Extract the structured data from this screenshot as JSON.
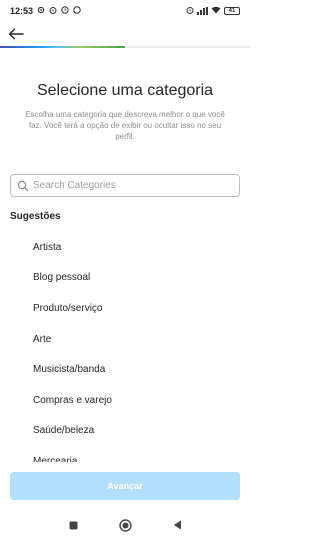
{
  "status_bar": {
    "time": "12:53",
    "battery": "41",
    "notification_icons": [
      "gear-icon",
      "alarm-icon",
      "clock-icon",
      "whatsapp-icon"
    ],
    "system_icons": [
      "alarm-icon",
      "wifi-icon",
      "signal-icon",
      "battery-icon"
    ]
  },
  "header": {
    "back_icon": "arrow-left-icon",
    "progress": 0.5,
    "progress_colors": [
      "#3f51b5",
      "#2196f3",
      "#4fc3f7",
      "#9ccc65",
      "#43a047"
    ]
  },
  "main": {
    "title": "Selecione uma categoria",
    "subtitle": "Escolha uma categoria que descreva melhor o que você faz. Você terá a opção de exibir ou ocultar isso no seu perfil.",
    "search": {
      "placeholder": "Search Categories",
      "value": ""
    },
    "suggestions_label": "Sugestões",
    "categories": [
      "Artista",
      "Blog pessoal",
      "Produto/serviço",
      "Arte",
      "Musicista/banda",
      "Compras e varejo",
      "Saúde/beleza",
      "Mercearia"
    ]
  },
  "footer": {
    "advance_label": "Avançar",
    "button_color": "#b2dffc"
  },
  "nav_bar": {
    "icons": [
      "recents-square-icon",
      "home-circle-icon",
      "back-triangle-icon"
    ]
  }
}
